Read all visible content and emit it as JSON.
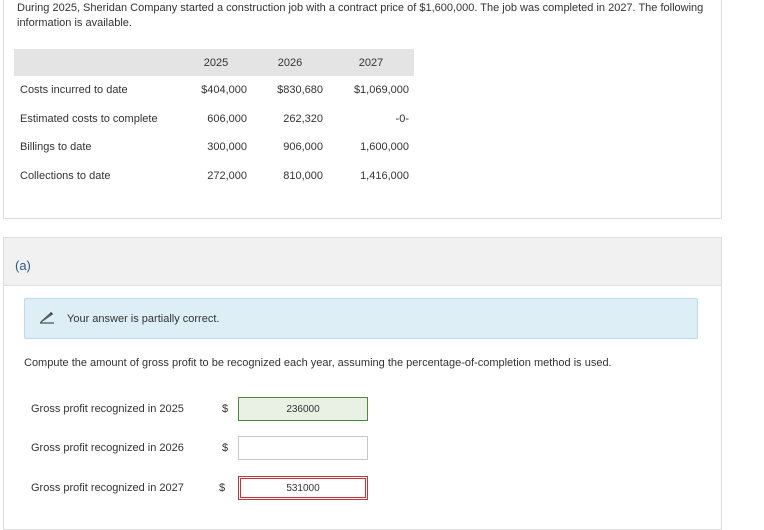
{
  "problem": {
    "intro": "During 2025, Sheridan Company started a construction job with a contract price of $1,600,000. The job was completed in 2027. The following information is available.",
    "years": [
      "2025",
      "2026",
      "2027"
    ],
    "rows": [
      {
        "label": "Costs incurred to date",
        "values": [
          "$404,000",
          "$830,680",
          "$1,069,000"
        ]
      },
      {
        "label": "Estimated costs to complete",
        "values": [
          "606,000",
          "262,320",
          "-0-"
        ]
      },
      {
        "label": "Billings to date",
        "values": [
          "300,000",
          "906,000",
          "1,600,000"
        ]
      },
      {
        "label": "Collections to date",
        "values": [
          "272,000",
          "810,000",
          "1,416,000"
        ]
      }
    ]
  },
  "part": {
    "letter": "(a)",
    "feedback": "Your answer is partially correct.",
    "feedback_icon": "pencil-icon",
    "question": "Compute the amount of gross profit to be recognized each year, assuming the percentage-of-completion method is used.",
    "answers": [
      {
        "label": "Gross profit recognized in 2025",
        "currency": "$",
        "value": "236000",
        "status": "correct"
      },
      {
        "label": "Gross profit recognized in 2026",
        "currency": "$",
        "value": "",
        "status": "empty"
      },
      {
        "label": "Gross profit recognized in 2027",
        "currency": "$",
        "value": "531000",
        "status": "incorrect"
      }
    ]
  },
  "colors": {
    "feedback_bg": "#ddeef6",
    "correct_border": "#4e8a3a",
    "correct_bg": "#e8f1e4",
    "incorrect_border": "#c83232",
    "part_letter": "#2a5a8c"
  }
}
